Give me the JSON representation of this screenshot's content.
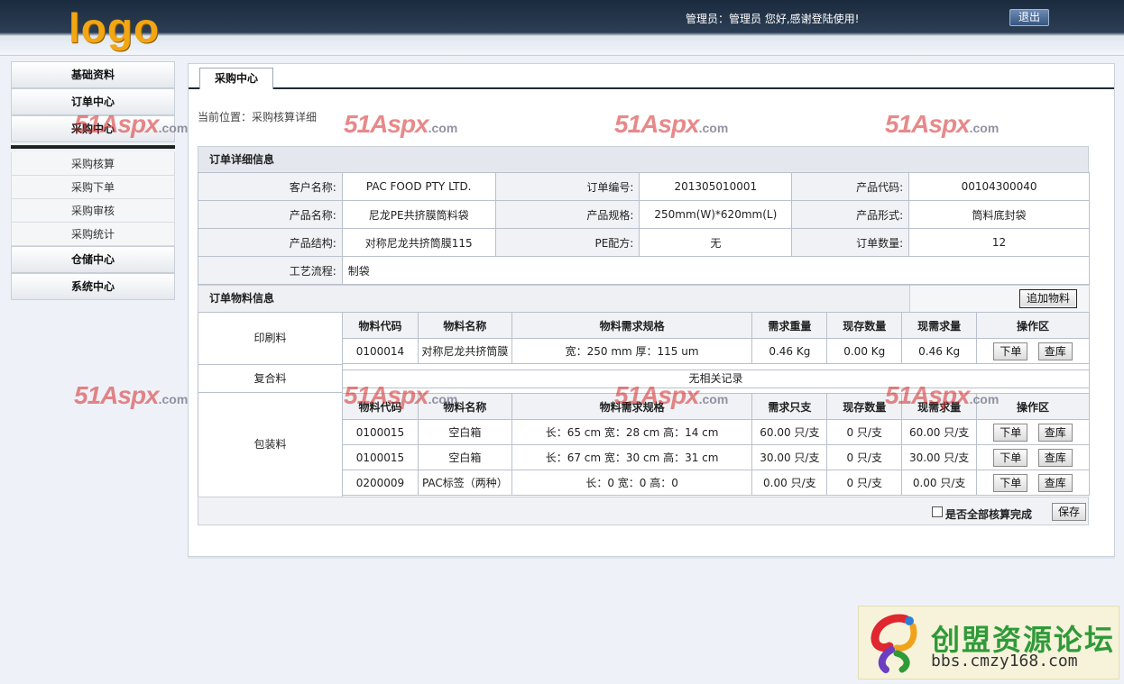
{
  "header": {
    "logo_text": "logo",
    "welcome": "管理员：管理员  您好,感谢登陆使用!",
    "logout_label": "退出"
  },
  "sidebar": {
    "categories": [
      "基础资料",
      "订单中心",
      "采购中心"
    ],
    "sub_items": [
      "采购核算",
      "采购下单",
      "采购审核",
      "采购统计"
    ],
    "bottom_categories": [
      "仓储中心",
      "系统中心"
    ]
  },
  "main": {
    "tab_label": "采购中心",
    "breadcrumb": "当前位置：采购核算详细",
    "order_section_title": "订单详细信息",
    "material_section_title": "订单物料信息",
    "add_material_label": "追加物料",
    "order": [
      [
        {
          "label": "客户名称:",
          "value": "PAC FOOD PTY LTD."
        },
        {
          "label": "订单编号:",
          "value": "201305010001"
        },
        {
          "label": "产品代码:",
          "value": "00104300040"
        }
      ],
      [
        {
          "label": "产品名称:",
          "value": "尼龙PE共挤膜筒料袋"
        },
        {
          "label": "产品规格:",
          "value": "250mm(W)*620mm(L)"
        },
        {
          "label": "产品形式:",
          "value": "筒料底封袋"
        }
      ],
      [
        {
          "label": "产品结构:",
          "value": "对称尼龙共挤筒膜115"
        },
        {
          "label": "PE配方:",
          "value": "无"
        },
        {
          "label": "订单数量:",
          "value": "12"
        }
      ]
    ],
    "process_label": "工艺流程:",
    "process_value": "制袋",
    "print_group": {
      "name": "印刷料",
      "headers": [
        "物料代码",
        "物料名称",
        "物料需求规格",
        "需求重量",
        "现存数量",
        "现需求量",
        "操作区"
      ],
      "rows": [
        [
          "0100014",
          "对称尼龙共挤筒膜",
          "宽：250 mm 厚：115 um",
          "0.46 Kg",
          "0.00 Kg",
          "0.46 Kg"
        ]
      ]
    },
    "composite_group": {
      "name": "复合料",
      "empty_text": "无相关记录"
    },
    "packing_group": {
      "name": "包装料",
      "headers": [
        "物料代码",
        "物料名称",
        "物料需求规格",
        "需求只支",
        "现存数量",
        "现需求量",
        "操作区"
      ],
      "rows": [
        [
          "0100015",
          "空白箱",
          "长：65 cm 宽：28 cm 高：14 cm",
          "60.00 只/支",
          "0 只/支",
          "60.00 只/支"
        ],
        [
          "0100015",
          "空白箱",
          "长：67 cm 宽：30 cm 高：31 cm",
          "30.00 只/支",
          "0 只/支",
          "30.00 只/支"
        ],
        [
          "0200009",
          "PAC标签（两种）",
          "长：0 宽：0 高：0",
          "0.00 只/支",
          "0 只/支",
          "0.00 只/支"
        ]
      ]
    },
    "order_btn_label": "下单",
    "stock_btn_label": "查库",
    "all_done_label": "是否全部核算完成",
    "save_label": "保存"
  },
  "watermark": {
    "main": "51Aspx",
    "suffix": ".com"
  },
  "brand": {
    "name": "创盟资源论坛",
    "url": "bbs.cmzy168.com"
  }
}
